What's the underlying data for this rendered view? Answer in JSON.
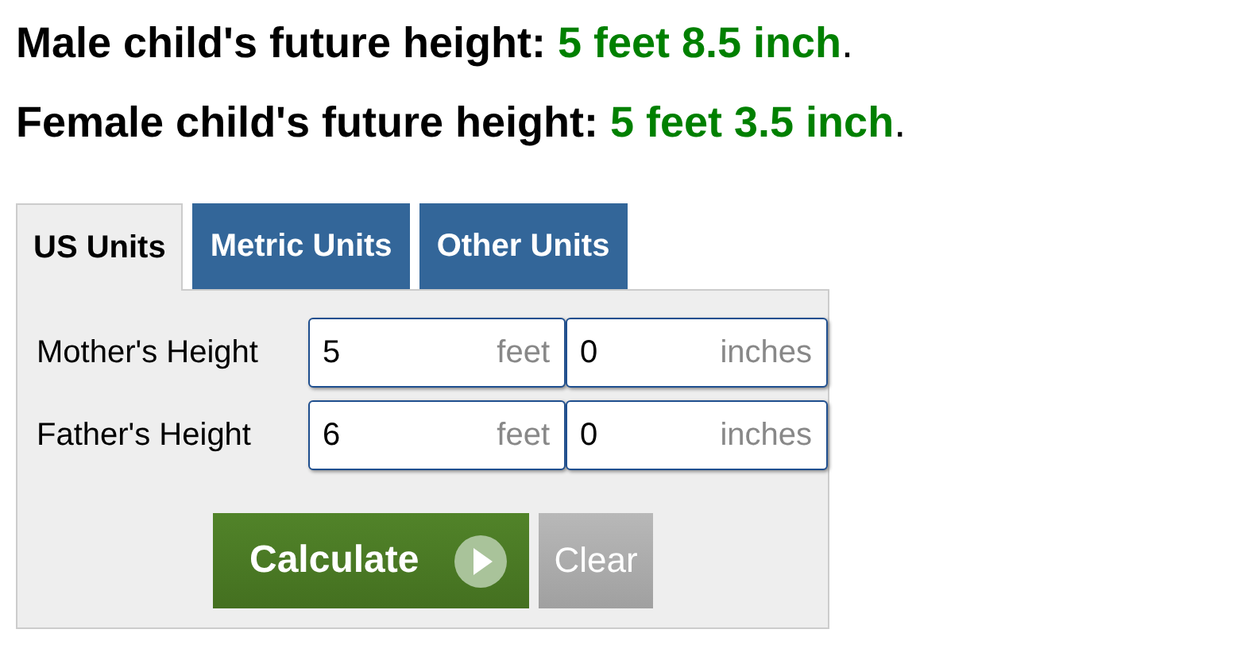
{
  "results": [
    {
      "label": "Male child's future height:",
      "value": "5 feet 8.5 inch",
      "end": "."
    },
    {
      "label": "Female child's future height:",
      "value": "5 feet 3.5 inch",
      "end": "."
    }
  ],
  "tabs": [
    {
      "label": "US Units",
      "selected": true
    },
    {
      "label": "Metric Units",
      "selected": false
    },
    {
      "label": "Other Units",
      "selected": false
    }
  ],
  "rows": [
    {
      "label": "Mother's Height",
      "fields": [
        {
          "value": "5",
          "unit": "feet"
        },
        {
          "value": "0",
          "unit": "inches"
        }
      ]
    },
    {
      "label": "Father's Height",
      "fields": [
        {
          "value": "6",
          "unit": "feet"
        },
        {
          "value": "0",
          "unit": "inches"
        }
      ]
    }
  ],
  "buttons": [
    {
      "kind": "primary",
      "label": "Calculate"
    },
    {
      "kind": "secondary",
      "label": "Clear"
    }
  ]
}
